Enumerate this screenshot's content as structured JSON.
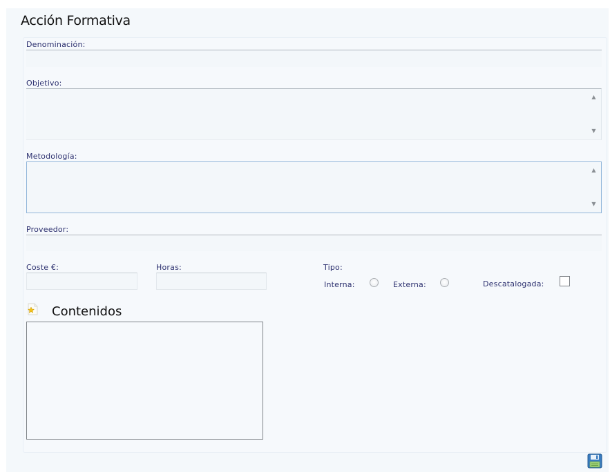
{
  "form": {
    "title": "Acción Formativa",
    "fields": {
      "denominacion": {
        "label": "Denominación:",
        "value": ""
      },
      "objetivo": {
        "label": "Objetivo:",
        "value": ""
      },
      "metodologia": {
        "label": "Metodología:",
        "value": ""
      },
      "proveedor": {
        "label": "Proveedor:",
        "value": ""
      },
      "coste": {
        "label": "Coste €:",
        "value": ""
      },
      "horas": {
        "label": "Horas:",
        "value": ""
      }
    },
    "tipo": {
      "label": "Tipo:",
      "interna_label": "Interna:",
      "externa_label": "Externa:",
      "interna_checked": false,
      "externa_checked": false
    },
    "descatalogada": {
      "label": "Descatalogada:",
      "checked": false
    }
  },
  "contenidos": {
    "title": "Contenidos",
    "icon": "star-document-icon"
  },
  "toolbar": {
    "save_icon": "save-icon"
  },
  "colors": {
    "label": "#2b2f6e",
    "panel_bg": "#f6f9fc",
    "focus_border": "#8fb4d9"
  }
}
